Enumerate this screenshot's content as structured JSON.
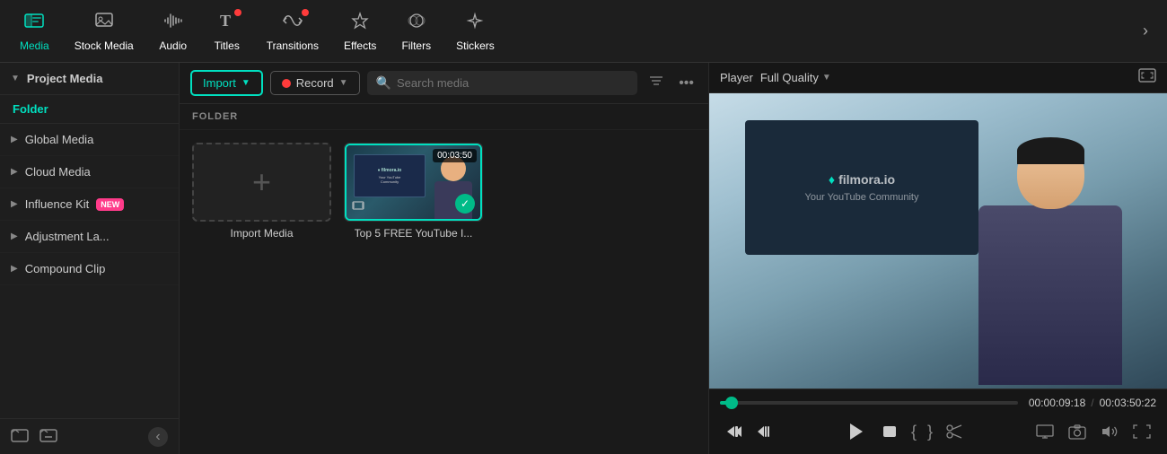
{
  "toolbar": {
    "items": [
      {
        "id": "media",
        "label": "Media",
        "icon": "🎬",
        "active": true,
        "dot": false
      },
      {
        "id": "stock-media",
        "label": "Stock Media",
        "icon": "🖼",
        "active": false,
        "dot": false
      },
      {
        "id": "audio",
        "label": "Audio",
        "icon": "♪",
        "active": false,
        "dot": false
      },
      {
        "id": "titles",
        "label": "Titles",
        "icon": "T",
        "active": false,
        "dot": true
      },
      {
        "id": "transitions",
        "label": "Transitions",
        "icon": "↔",
        "active": false,
        "dot": true
      },
      {
        "id": "effects",
        "label": "Effects",
        "icon": "✦",
        "active": false,
        "dot": false
      },
      {
        "id": "filters",
        "label": "Filters",
        "icon": "⬡",
        "active": false,
        "dot": false
      },
      {
        "id": "stickers",
        "label": "Stickers",
        "icon": "♠",
        "active": false,
        "dot": false
      }
    ],
    "more_label": "›"
  },
  "sidebar": {
    "header": "Project Media",
    "folder_label": "Folder",
    "items": [
      {
        "id": "global-media",
        "label": "Global Media",
        "badge": null
      },
      {
        "id": "cloud-media",
        "label": "Cloud Media",
        "badge": null
      },
      {
        "id": "influence-kit",
        "label": "Influence Kit",
        "badge": "NEW"
      },
      {
        "id": "adjustment-la",
        "label": "Adjustment La...",
        "badge": null
      },
      {
        "id": "compound-clip",
        "label": "Compound Clip",
        "badge": null
      }
    ],
    "footer": {
      "icon1": "⊞",
      "icon2": "⊟"
    }
  },
  "media": {
    "import_label": "Import",
    "record_label": "Record",
    "search_placeholder": "Search media",
    "folder_section": "FOLDER",
    "import_media_label": "Import Media",
    "video_label": "Top 5 FREE YouTube I...",
    "video_duration": "00:03:50",
    "video_brand": "filmora.io",
    "video_subtitle": "Your YouTube Community"
  },
  "player": {
    "title": "Player",
    "quality": "Full Quality",
    "current_time": "00:00:09:18",
    "total_time": "00:03:50:22",
    "time_separator": "/",
    "progress_pct": 4
  }
}
